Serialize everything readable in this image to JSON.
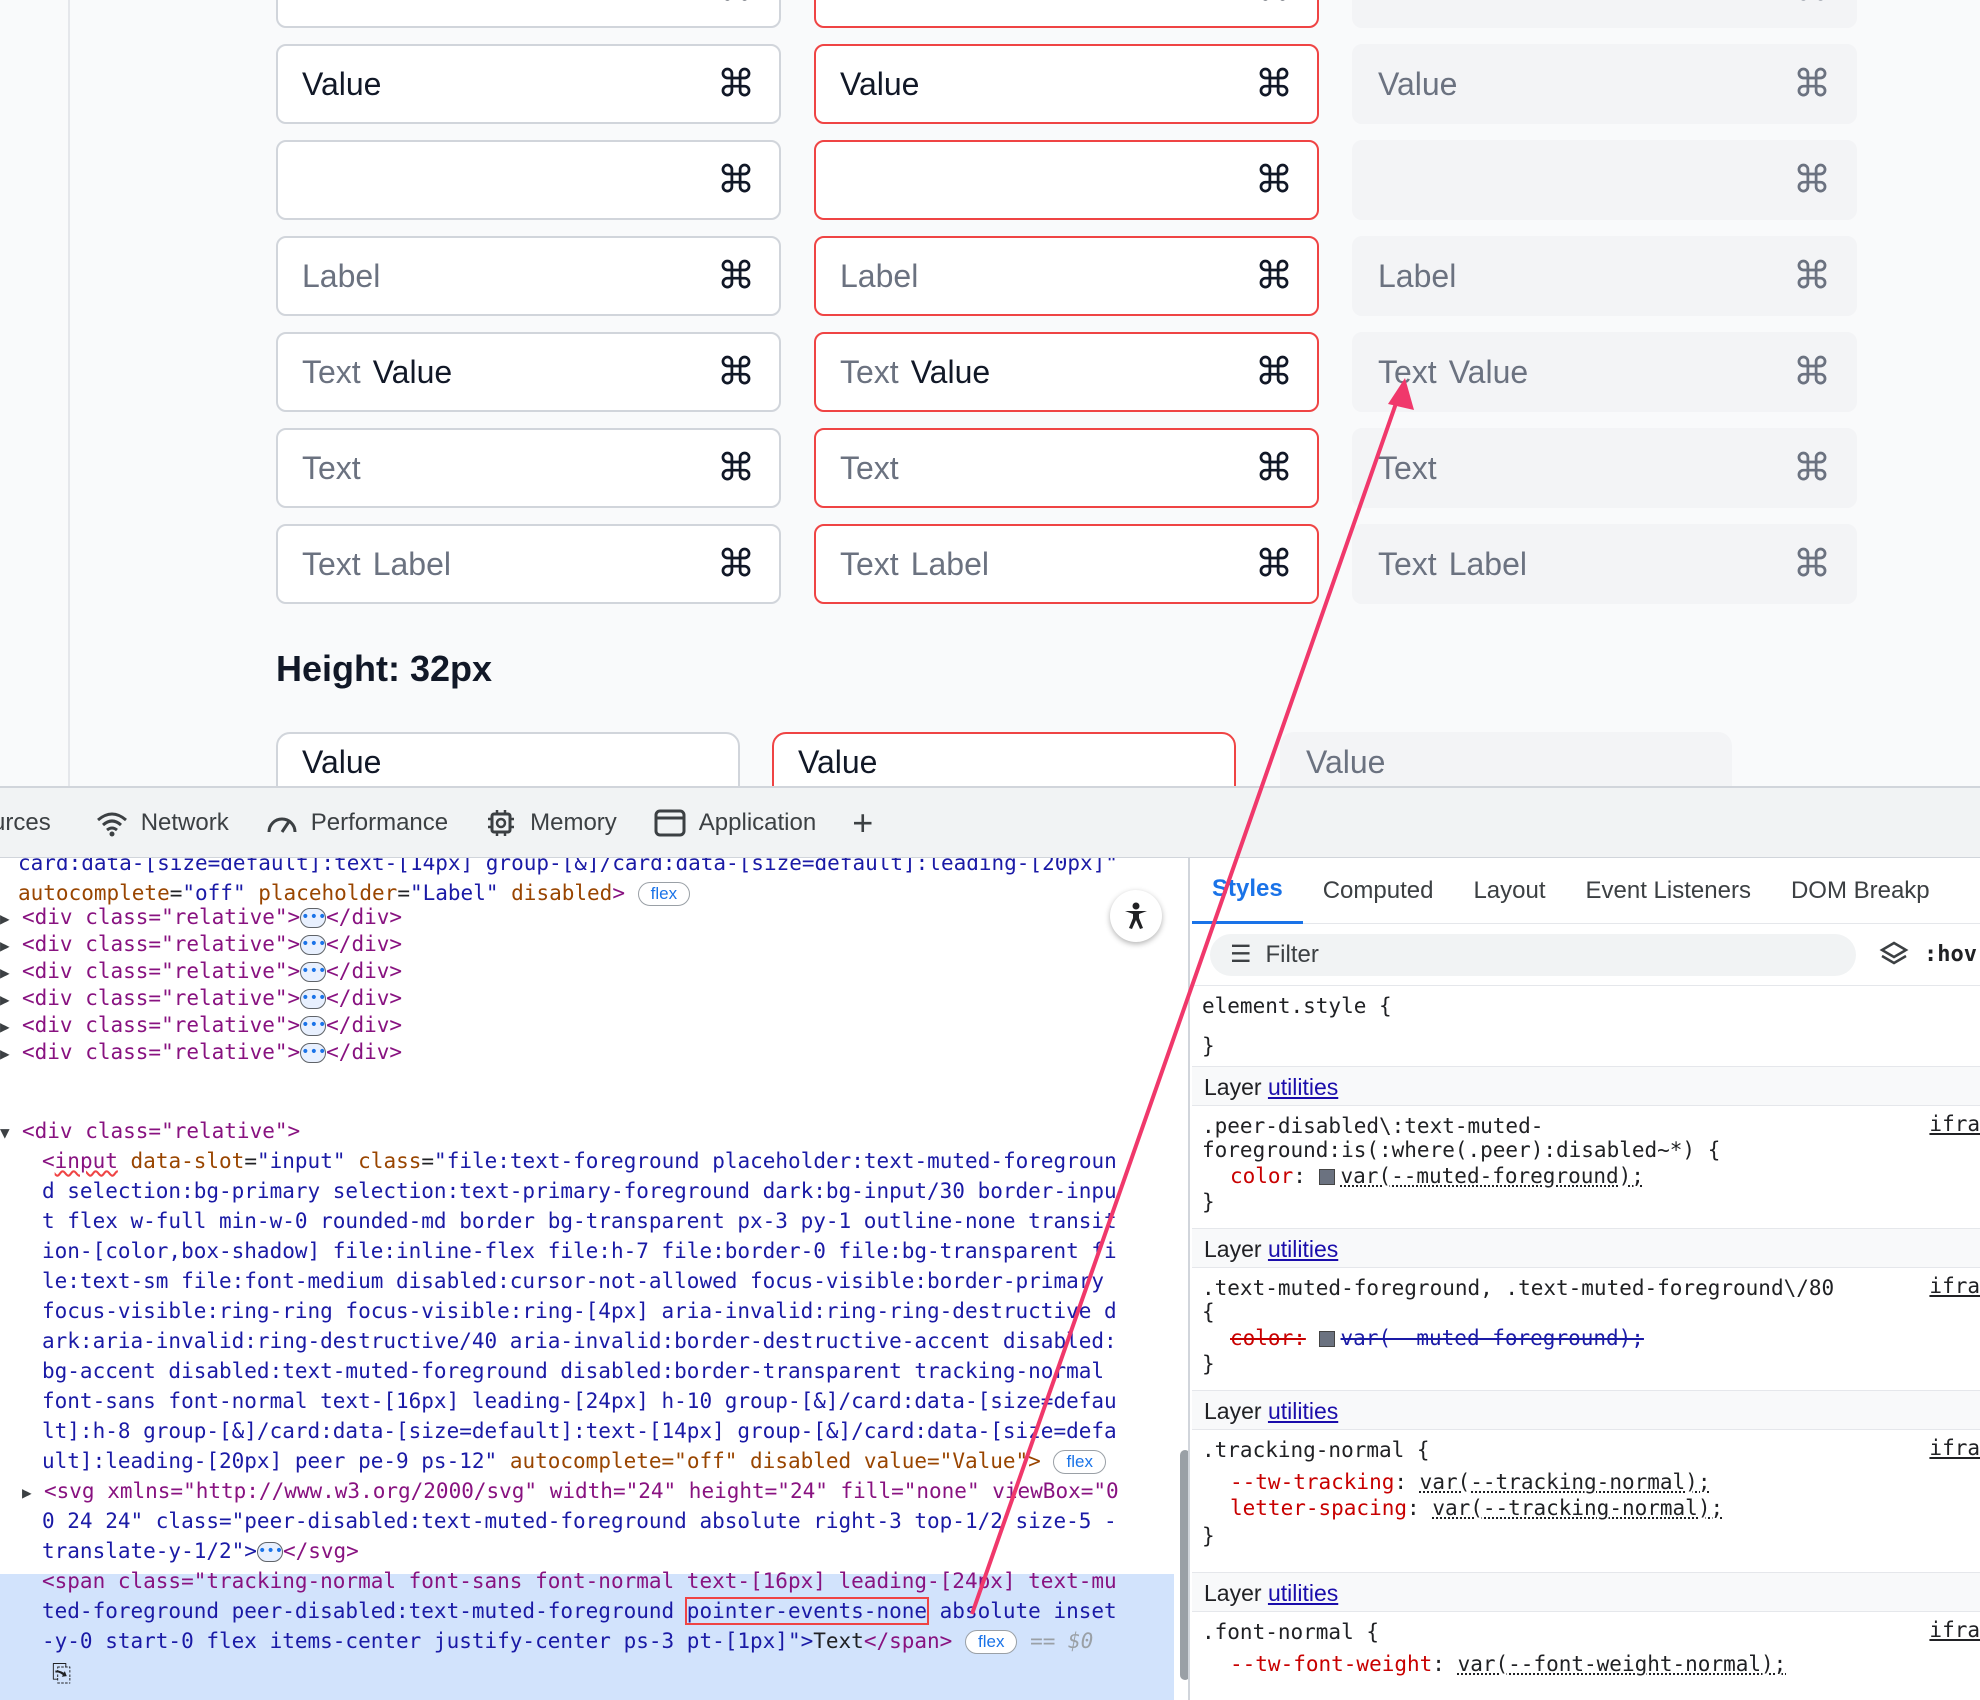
{
  "preview": {
    "rows": [
      {
        "kind": "value",
        "value": "Value"
      },
      {
        "kind": "empty"
      },
      {
        "kind": "label",
        "label": "Label"
      },
      {
        "kind": "text-value",
        "prefix": "Text",
        "value": "Value"
      },
      {
        "kind": "text",
        "prefix": "Text"
      },
      {
        "kind": "text-label",
        "prefix": "Text",
        "label": "Label"
      }
    ],
    "cmd_glyph": "⌘",
    "height_heading": "Height: 32px",
    "small_row": {
      "value": "Value"
    }
  },
  "devtools": {
    "tabs": [
      {
        "label": "urces",
        "icon": ""
      },
      {
        "label": "Network",
        "icon": "wifi-icon"
      },
      {
        "label": "Performance",
        "icon": "speedometer-icon"
      },
      {
        "label": "Memory",
        "icon": "chip-icon"
      },
      {
        "label": "Application",
        "icon": "window-icon"
      },
      {
        "label": "+",
        "icon": "plus-icon"
      }
    ],
    "elements": {
      "line0": "card:data-[size=default]:text-[14px] group-[&]/card:data-[size=default]:leading-[20px]\"",
      "line1_attr1": "autocomplete",
      "line1_val1": "\"off\"",
      "line1_attr2": "placeholder",
      "line1_val2": "\"Label\"",
      "line1_attr3": "disabled",
      "flex_badge": "flex",
      "collapsed_div": "<div class=\"relative\">",
      "collapsed_end": "</div>",
      "open_div": "<div class=\"relative\">",
      "input_lines": [
        "d selection:bg-primary selection:text-primary-foreground dark:bg-input/30 border-inpu",
        "t flex w-full min-w-0 rounded-md border bg-transparent px-3 py-1 outline-none transit",
        "ion-[color,box-shadow] file:inline-flex file:h-7 file:border-0 file:bg-transparent fi",
        "le:text-sm file:font-medium disabled:cursor-not-allowed focus-visible:border-primary",
        "focus-visible:ring-ring focus-visible:ring-[4px] aria-invalid:ring-ring-destructive d",
        "ark:aria-invalid:ring-destructive/40 aria-invalid:border-destructive-accent disabled:",
        "bg-accent disabled:text-muted-foreground disabled:border-transparent tracking-normal",
        "font-sans font-normal text-[16px] leading-[24px] h-10 group-[&]/card:data-[size=defau",
        "lt]:h-8 group-[&]/card:data-[size=default]:text-[14px] group-[&]/card:data-[size=defa"
      ],
      "input_first": "file:text-foreground placeholder:text-muted-foregroun",
      "input_last_cls": "ult]:leading-[20px] peer pe-9 ps-12\"",
      "input_last_rest": "autocomplete=\"off\" disabled value=\"Value\">",
      "svg_line1": "<svg xmlns=\"http://www.w3.org/2000/svg\" width=\"24\" height=\"24\" fill=\"none\" viewBox=\"0",
      "svg_line2": "0 24 24\" class=\"peer-disabled:text-muted-foreground absolute right-3 top-1/2 size-5 -",
      "svg_line3": "translate-y-1/2\">",
      "svg_end": "</svg>",
      "span_line1": "<span class=\"tracking-normal font-sans font-normal text-[16px] leading-[24px] text-mu",
      "span_line2a": "ted-foreground peer-disabled:text-muted-foreground ",
      "span_highlight": "pointer-events-none",
      "span_line2b": " absolute inset",
      "span_line3": "-y-0 start-0 flex items-center justify-center ps-3 pt-[1px]\">",
      "span_text": "Text",
      "span_end": "</span>",
      "dollar0": "== $0"
    },
    "styles": {
      "tabs": [
        "Styles",
        "Computed",
        "Layout",
        "Event Listeners",
        "DOM Breakp"
      ],
      "filter_placeholder": "Filter",
      "hov": ":hov",
      "element_style": "element.style {",
      "close_brace": "}",
      "layer_prefix": "Layer",
      "layer_link": "utilities",
      "source": "ifra",
      "rule1_sel1": ".peer-disabled\\:text-muted-",
      "rule1_sel2": "foreground:is(:where(.peer):disabled~*) {",
      "rule1_prop": "color",
      "rule1_val": "var(--muted-foreground);",
      "rule2_sel": ".text-muted-foreground, .text-muted-foreground\\/80",
      "rule2_open": "{",
      "rule2_prop": "color:",
      "rule2_val": "var(--muted-foreground);",
      "rule3_sel": ".tracking-normal {",
      "rule3_p1": "--tw-tracking",
      "rule3_v1": "var(--tracking-normal);",
      "rule3_p2": "letter-spacing",
      "rule3_v2": "var(--tracking-normal);",
      "rule4_sel": ".font-normal {",
      "rule4_p1": "--tw-font-weight",
      "rule4_v1": "var(--font-weight-normal);"
    }
  },
  "colors": {
    "error_border": "#ef4444",
    "accent_blue": "#1a73e8",
    "arrow": "#f0386b"
  }
}
